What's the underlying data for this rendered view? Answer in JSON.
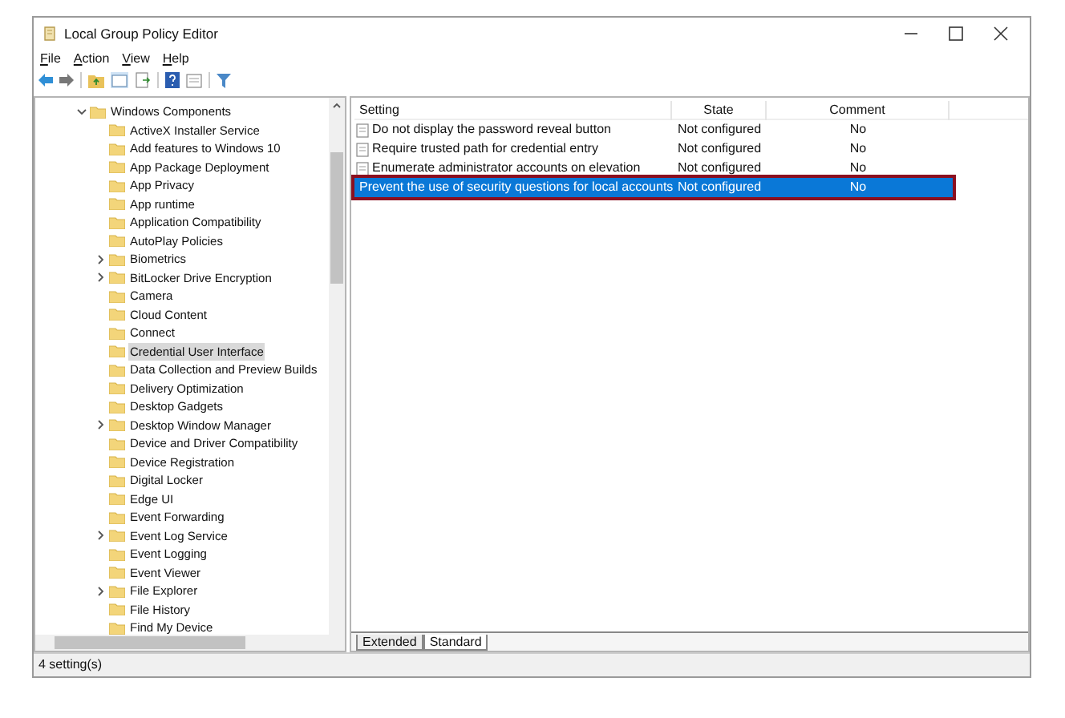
{
  "window": {
    "title": "Local Group Policy Editor"
  },
  "menu": [
    "File",
    "Action",
    "View",
    "Help"
  ],
  "tree": [
    {
      "label": "Windows Components",
      "expanded": true,
      "selected": false,
      "children": [
        {
          "label": "ActiveX Installer Service",
          "selected": false
        },
        {
          "label": "Add features to Windows 10",
          "selected": false
        },
        {
          "label": "App Package Deployment",
          "selected": false
        },
        {
          "label": "App Privacy",
          "selected": false
        },
        {
          "label": "App runtime",
          "selected": false
        },
        {
          "label": "Application Compatibility",
          "selected": false
        },
        {
          "label": "AutoPlay Policies",
          "selected": false
        },
        {
          "label": "Biometrics",
          "expanded": false,
          "selected": false
        },
        {
          "label": "BitLocker Drive Encryption",
          "expanded": false,
          "selected": false
        },
        {
          "label": "Camera",
          "selected": false
        },
        {
          "label": "Cloud Content",
          "selected": false
        },
        {
          "label": "Connect",
          "selected": false
        },
        {
          "label": "Credential User Interface",
          "selected": true
        },
        {
          "label": "Data Collection and Preview Builds",
          "selected": false
        },
        {
          "label": "Delivery Optimization",
          "selected": false
        },
        {
          "label": "Desktop Gadgets",
          "selected": false
        },
        {
          "label": "Desktop Window Manager",
          "expanded": false,
          "selected": false
        },
        {
          "label": "Device and Driver Compatibility",
          "selected": false
        },
        {
          "label": "Device Registration",
          "selected": false
        },
        {
          "label": "Digital Locker",
          "selected": false
        },
        {
          "label": "Edge UI",
          "selected": false
        },
        {
          "label": "Event Forwarding",
          "selected": false
        },
        {
          "label": "Event Log Service",
          "expanded": false,
          "selected": false
        },
        {
          "label": "Event Logging",
          "selected": false
        },
        {
          "label": "Event Viewer",
          "selected": false
        },
        {
          "label": "File Explorer",
          "expanded": false,
          "selected": false
        },
        {
          "label": "File History",
          "selected": false
        },
        {
          "label": "Find My Device",
          "selected": false
        }
      ]
    }
  ],
  "table": {
    "columns": [
      "Setting",
      "State",
      "Comment"
    ],
    "rows": [
      {
        "setting": "Do not display the password reveal button",
        "state": "Not configured",
        "comment": "No",
        "selected": false,
        "outlined": false
      },
      {
        "setting": "Require trusted path for credential entry",
        "state": "Not configured",
        "comment": "No",
        "selected": false,
        "outlined": false
      },
      {
        "setting": "Enumerate administrator accounts on elevation",
        "state": "Not configured",
        "comment": "No",
        "selected": false,
        "outlined": false
      },
      {
        "setting": "Prevent the use of security questions for local accounts",
        "state": "Not configured",
        "comment": "No",
        "selected": true,
        "outlined": true
      }
    ]
  },
  "tabs": [
    {
      "label": "Extended",
      "selected": false
    },
    {
      "label": "Standard",
      "selected": true
    }
  ],
  "status_bar": "4 setting(s)"
}
